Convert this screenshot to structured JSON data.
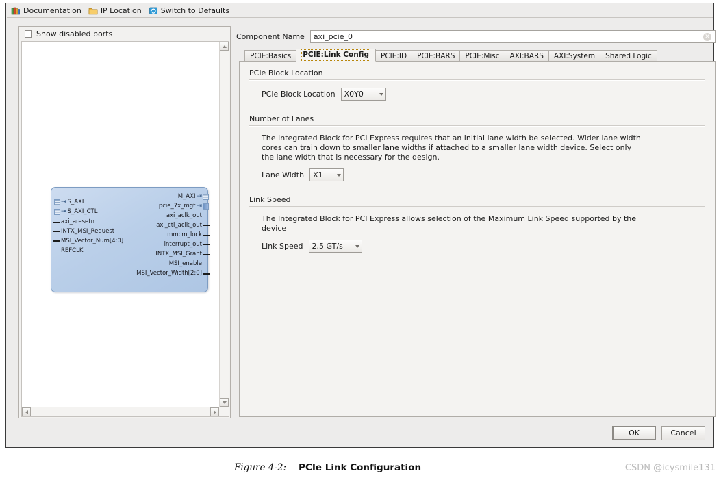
{
  "toolbar": {
    "items": [
      {
        "label": "Documentation",
        "icon": "books-icon"
      },
      {
        "label": "IP Location",
        "icon": "folder-icon"
      },
      {
        "label": "Switch to Defaults",
        "icon": "refresh-icon"
      }
    ]
  },
  "left_panel": {
    "show_disabled_ports_label": "Show disabled ports",
    "show_disabled_ports_checked": false,
    "block": {
      "left_ports": [
        {
          "name": "S_AXI",
          "type": "bus"
        },
        {
          "name": "S_AXI_CTL",
          "type": "bus"
        },
        {
          "name": "axi_aresetn",
          "type": "pin"
        },
        {
          "name": "INTX_MSI_Request",
          "type": "pin"
        },
        {
          "name": "MSI_Vector_Num[4:0]",
          "type": "vector"
        },
        {
          "name": "REFCLK",
          "type": "pin"
        }
      ],
      "right_ports": [
        {
          "name": "M_AXI",
          "type": "bus"
        },
        {
          "name": "pcie_7x_mgt",
          "type": "bus-solid"
        },
        {
          "name": "axi_aclk_out",
          "type": "pin"
        },
        {
          "name": "axi_ctl_aclk_out",
          "type": "pin"
        },
        {
          "name": "mmcm_lock",
          "type": "pin"
        },
        {
          "name": "interrupt_out",
          "type": "pin"
        },
        {
          "name": "INTX_MSI_Grant",
          "type": "pin"
        },
        {
          "name": "MSI_enable",
          "type": "pin"
        },
        {
          "name": "MSI_Vector_Width[2:0]",
          "type": "vector"
        }
      ]
    }
  },
  "right_panel": {
    "component_name_label": "Component Name",
    "component_name_value": "axi_pcie_0",
    "component_name_placeholder": "axi_pcie_0",
    "tabs": [
      {
        "label": "PCIE:Basics",
        "active": false
      },
      {
        "label": "PCIE:Link Config",
        "active": true
      },
      {
        "label": "PCIE:ID",
        "active": false
      },
      {
        "label": "PCIE:BARS",
        "active": false
      },
      {
        "label": "PCIE:Misc",
        "active": false
      },
      {
        "label": "AXI:BARS",
        "active": false
      },
      {
        "label": "AXI:System",
        "active": false
      },
      {
        "label": "Shared Logic",
        "active": false
      }
    ],
    "sections": [
      {
        "heading": "PCIe Block Location",
        "description": "",
        "field_label": "PCIe Block Location",
        "field_value": "X0Y0"
      },
      {
        "heading": "Number of Lanes",
        "description": "The Integrated Block for PCI Express requires that an initial lane width be selected. Wider lane width cores can train down to smaller lane widths if attached to a smaller lane width device. Select only the lane width that is necessary for the design.",
        "field_label": "Lane Width",
        "field_value": "X1"
      },
      {
        "heading": "Link Speed",
        "description": "The Integrated Block for PCI Express allows selection of the Maximum Link Speed supported by the device",
        "field_label": "Link Speed",
        "field_value": "2.5 GT/s"
      }
    ]
  },
  "buttons": {
    "ok_label": "OK",
    "cancel_label": "Cancel"
  },
  "caption": {
    "figure_number": "Figure 4-2:",
    "figure_title": "PCIe Link Configuration",
    "watermark": "CSDN @icysmile131"
  },
  "colors": {
    "dialog_bg": "#edeceb",
    "panel_bg": "#f4f3f1",
    "block_fill": "#bacfe9",
    "block_border": "#7d9cc2",
    "active_tab_focus": "#b8860b"
  }
}
